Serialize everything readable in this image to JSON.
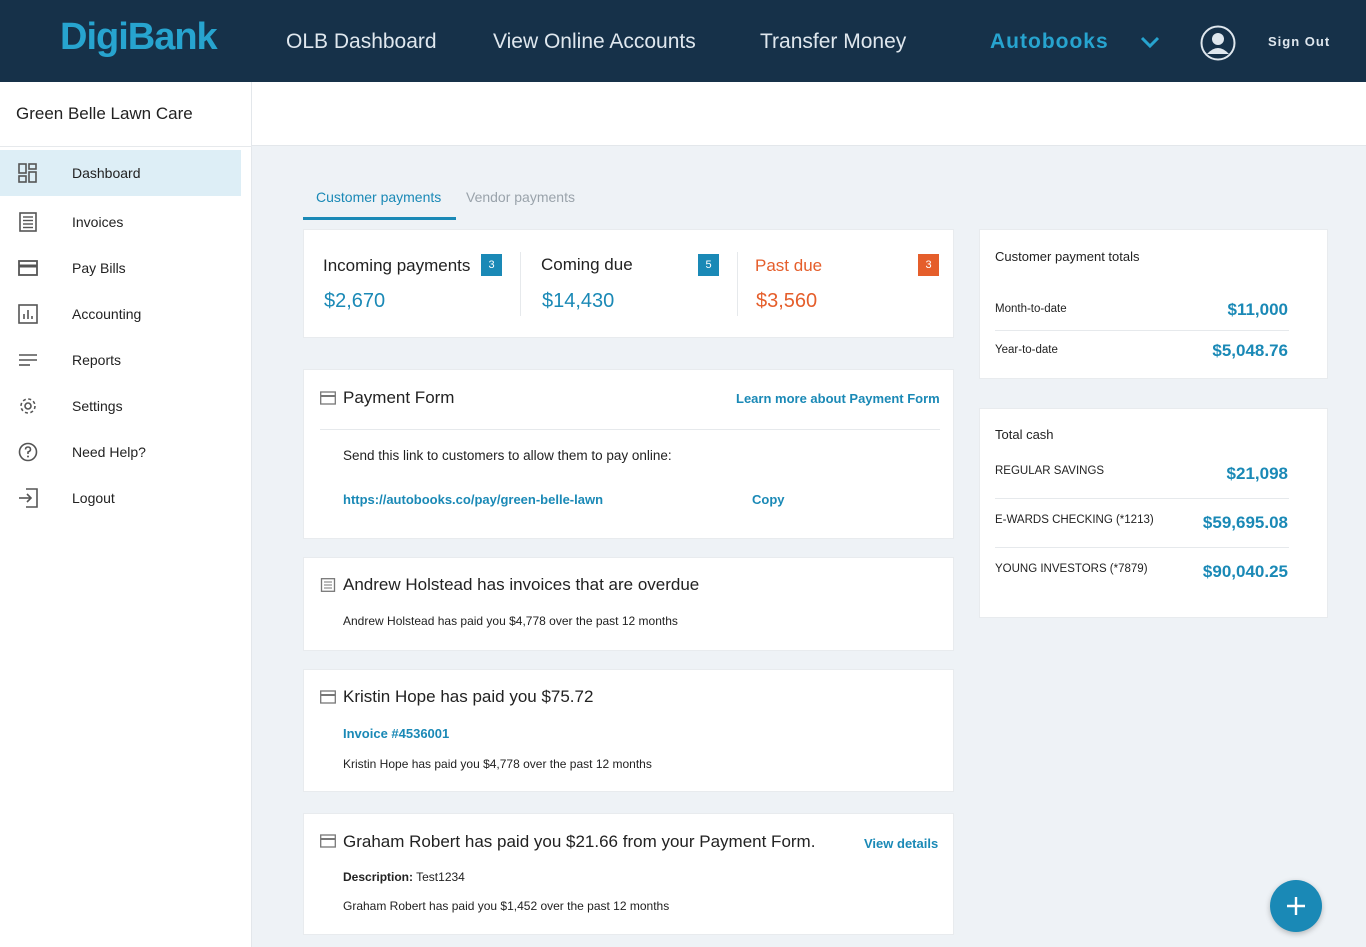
{
  "brand": {
    "logo": "DigiBank"
  },
  "topnav": {
    "links": [
      "OLB Dashboard",
      "View Online Accounts",
      "Transfer Money"
    ],
    "active": "Autobooks",
    "signout": "Sign Out"
  },
  "sidebar": {
    "company": "Green Belle Lawn Care",
    "items": [
      {
        "label": "Dashboard",
        "icon": "dashboard-icon"
      },
      {
        "label": "Invoices",
        "icon": "invoice-icon"
      },
      {
        "label": "Pay Bills",
        "icon": "credit-card-icon"
      },
      {
        "label": "Accounting",
        "icon": "bar-chart-icon"
      },
      {
        "label": "Reports",
        "icon": "lines-icon"
      },
      {
        "label": "Settings",
        "icon": "gear-icon"
      },
      {
        "label": "Need Help?",
        "icon": "help-icon"
      },
      {
        "label": "Logout",
        "icon": "logout-icon"
      }
    ]
  },
  "tabs": {
    "customer": "Customer payments",
    "vendor": "Vendor payments"
  },
  "stats": {
    "incoming": {
      "title": "Incoming payments",
      "count": "3",
      "amount": "$2,670"
    },
    "coming": {
      "title": "Coming due",
      "count": "5",
      "amount": "$14,430"
    },
    "past": {
      "title": "Past due",
      "count": "3",
      "amount": "$3,560"
    }
  },
  "payment_form": {
    "title": "Payment Form",
    "learn_more": "Learn more about Payment Form",
    "instructions": "Send this link to customers to allow them to pay online:",
    "url": "https://autobooks.co/pay/green-belle-lawn",
    "copy": "Copy"
  },
  "activity": {
    "andrew": {
      "title": "Andrew Holstead has invoices that are overdue",
      "sub": "Andrew Holstead has paid you $4,778 over the past 12 months"
    },
    "kristin": {
      "title": "Kristin Hope has paid you $75.72",
      "invoice": "Invoice #4536001",
      "sub": "Kristin Hope has paid you $4,778 over the past 12 months"
    },
    "graham": {
      "title": "Graham Robert has paid you $21.66 from your Payment Form.",
      "view": "View details",
      "desc_label": "Description:",
      "desc_value": " Test1234",
      "sub": "Graham Robert has paid you $1,452 over the past 12 months"
    }
  },
  "totals": {
    "title": "Customer payment totals",
    "mtd_label": "Month-to-date",
    "mtd_value": "$11,000",
    "ytd_label": "Year-to-date",
    "ytd_value": "$5,048.76"
  },
  "cash": {
    "title": "Total cash",
    "accounts": [
      {
        "label": "REGULAR SAVINGS",
        "value": "$21,098"
      },
      {
        "label": "E-WARDS CHECKING (*1213)",
        "value": "$59,695.08"
      },
      {
        "label": "YOUNG INVESTORS (*7879)",
        "value": "$90,040.25"
      }
    ]
  },
  "colors": {
    "navy": "#163149",
    "accent": "#1a89b6",
    "orange": "#e55e2b"
  }
}
